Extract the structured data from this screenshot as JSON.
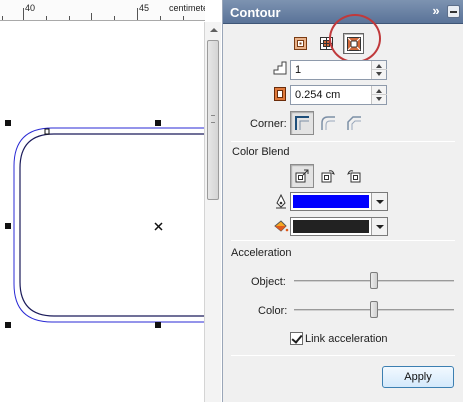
{
  "ruler": {
    "num_40": "40",
    "num_45": "45",
    "units": "centimeters"
  },
  "docker": {
    "title": "Contour",
    "expand_glyph": "»",
    "steps_value": "1",
    "offset_value": "0.254 cm",
    "corner_label": "Corner:",
    "color_blend_label": "Color Blend",
    "outline_color": "#0000ff",
    "fill_color": "#222222",
    "acceleration_label": "Acceleration",
    "object_label": "Object:",
    "color_label": "Color:",
    "object_accel": 0.5,
    "color_accel": 0.5,
    "link_checked": true,
    "link_label": "Link acceleration",
    "apply_label": "Apply"
  },
  "icons": {
    "direction": [
      "to-center-icon",
      "inside-contour-icon",
      "outside-contour-icon"
    ],
    "corner": [
      "miter-corner-icon",
      "round-corner-icon",
      "bevel-corner-icon"
    ],
    "blend": [
      "linear-blend-icon",
      "clockwise-blend-icon",
      "counterclockwise-blend-icon"
    ]
  }
}
